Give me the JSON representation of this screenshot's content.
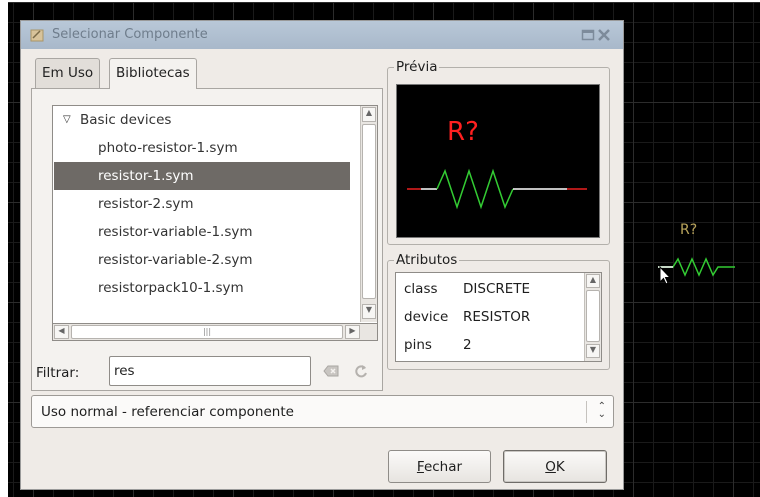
{
  "dialog": {
    "title": "Selecionar Componente",
    "tabs": [
      {
        "label": "Em Uso",
        "active": false
      },
      {
        "label": "Bibliotecas",
        "active": true
      }
    ],
    "tree": {
      "root": "Basic devices",
      "items": [
        {
          "label": "photo-resistor-1.sym",
          "selected": false
        },
        {
          "label": "resistor-1.sym",
          "selected": true
        },
        {
          "label": "resistor-2.sym",
          "selected": false
        },
        {
          "label": "resistor-variable-1.sym",
          "selected": false
        },
        {
          "label": "resistor-variable-2.sym",
          "selected": false
        },
        {
          "label": "resistorpack10-1.sym",
          "selected": false
        }
      ]
    },
    "filter": {
      "label": "Filtrar:",
      "value": "res"
    },
    "preview": {
      "label": "Prévia",
      "refdes": "R?",
      "refdes_color": "#ff2020",
      "pin_color": "#b01818",
      "body_color": "#33cc33"
    },
    "attributes": {
      "label": "Atributos",
      "rows": [
        {
          "key": "class",
          "value": "DISCRETE"
        },
        {
          "key": "device",
          "value": "RESISTOR"
        },
        {
          "key": "pins",
          "value": "2"
        }
      ]
    },
    "mode": {
      "selected": "Uso normal - referenciar componente"
    },
    "buttons": {
      "close": {
        "mnemonic": "F",
        "rest": "echar"
      },
      "ok": {
        "mnemonic": "O",
        "rest": "K"
      }
    }
  },
  "canvas": {
    "symbol_refdes": "R?",
    "refdes_color": "#b9a45c",
    "symbol_color": "#33cc33"
  }
}
